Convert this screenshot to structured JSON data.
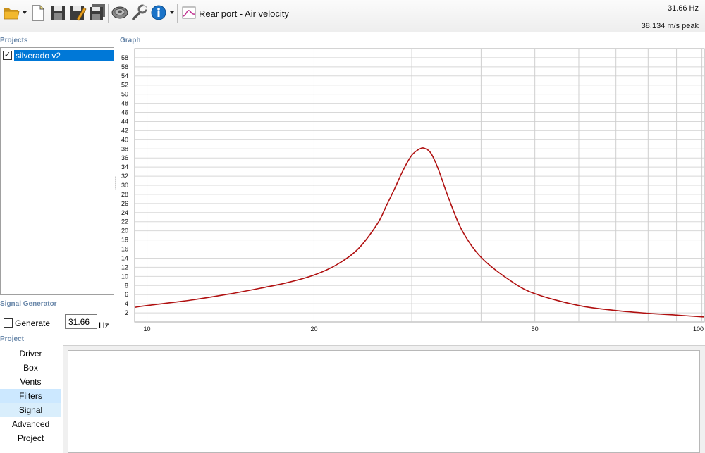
{
  "toolbar": {
    "icons": [
      "open-folder-icon",
      "new-document-icon",
      "save-icon",
      "save-as-icon",
      "save-all-icon",
      "speaker-icon",
      "wrench-icon",
      "info-icon",
      "chart-icon"
    ],
    "chart_title": "Rear port - Air velocity",
    "readout_frequency": "31.66 Hz",
    "readout_value": "38.134 m/s peak"
  },
  "projects": {
    "label": "Projects",
    "items": [
      {
        "name": "silverado v2",
        "checked": true
      }
    ]
  },
  "graph": {
    "label": "Graph"
  },
  "signal_generator": {
    "label": "Signal Generator",
    "generate_label": "Generate",
    "generate_checked": false,
    "frequency_value": "31.66",
    "unit": "Hz"
  },
  "project_nav": {
    "label": "Project",
    "items": [
      "Driver",
      "Box",
      "Vents",
      "Filters",
      "Signal",
      "Advanced",
      "Project"
    ]
  },
  "colors": {
    "curve": "#b01010",
    "selection": "#0078d7",
    "nav_highlight": "#cce8ff"
  },
  "chart_data": {
    "type": "line",
    "x_scale": "log",
    "xlim": [
      9.5,
      101
    ],
    "ylim": [
      0,
      60
    ],
    "x_ticks": [
      10,
      20,
      50,
      100
    ],
    "y_ticks": [
      2,
      4,
      6,
      8,
      10,
      12,
      14,
      16,
      18,
      20,
      22,
      24,
      26,
      28,
      30,
      32,
      34,
      36,
      38,
      40,
      42,
      44,
      46,
      48,
      50,
      52,
      54,
      56,
      58
    ],
    "grid": true,
    "series": [
      {
        "x": [
          9.5,
          10,
          12,
          14,
          16,
          18,
          20,
          22,
          24,
          26,
          27,
          28,
          29,
          30,
          31,
          31.66,
          32.5,
          33.5,
          35,
          37,
          40,
          45,
          50,
          60,
          70,
          80,
          90,
          101
        ],
        "values": [
          3.2,
          3.6,
          4.8,
          6.1,
          7.4,
          8.7,
          10.3,
          12.6,
          16,
          21.5,
          25.5,
          29.5,
          33.5,
          36.6,
          38,
          38.1,
          37,
          33.5,
          27,
          20,
          14.2,
          9.2,
          6.2,
          3.6,
          2.5,
          1.9,
          1.5,
          1.1
        ]
      }
    ]
  }
}
